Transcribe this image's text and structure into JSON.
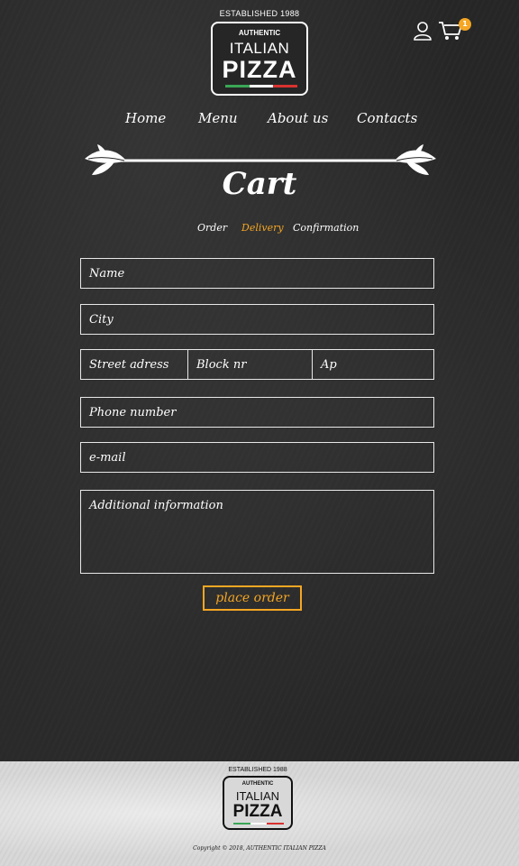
{
  "brand": {
    "established": "ESTABLISHED 1988",
    "authentic": "AUTHENTIC",
    "italian": "ITALIAN",
    "pizza": "PIZZA",
    "flag_colors": [
      "#3aa655",
      "#ffffff",
      "#d8312f"
    ]
  },
  "header": {
    "user_icon": "user-icon",
    "cart_icon": "cart-icon",
    "cart_count": "1"
  },
  "nav": {
    "items": [
      "Home",
      "Menu",
      "About us",
      "Contacts"
    ]
  },
  "page": {
    "title": "Cart"
  },
  "steps": {
    "items": [
      "Order",
      "Delivery",
      "Confirmation"
    ],
    "active": "Delivery"
  },
  "form": {
    "name": "Name",
    "city": "City",
    "street": "Street adress",
    "block": "Block nr",
    "apartment": "Ap",
    "phone": "Phone number",
    "email": "e-mail",
    "additional": "Additional information",
    "submit": "place order"
  },
  "footer": {
    "copyright": "Copyright © 2018, AUTHENTIC ITALIAN PIZZA"
  },
  "colors": {
    "accent": "#f5a623",
    "chalkboard": "#262626",
    "footer_bg": "#d8d8d8"
  }
}
